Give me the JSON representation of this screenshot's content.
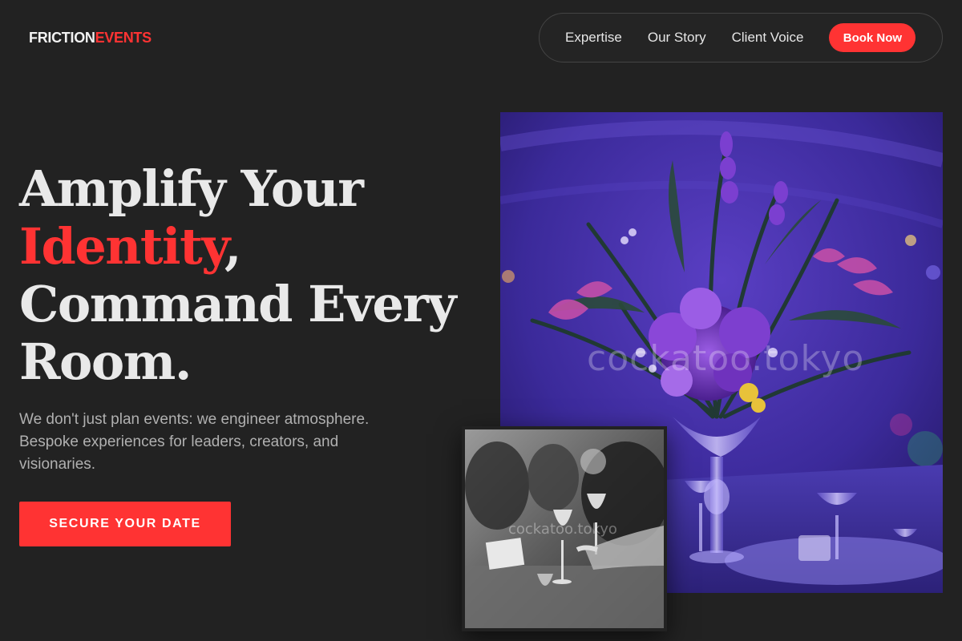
{
  "header": {
    "logo_word1": "FRICTION",
    "logo_word2": "EVENTS",
    "nav": {
      "items": [
        {
          "label": "Expertise"
        },
        {
          "label": "Our Story"
        },
        {
          "label": "Client Voice"
        }
      ],
      "book_label": "Book Now"
    }
  },
  "hero": {
    "headline_line1": "Amplify Your",
    "headline_accent": "Identity",
    "headline_comma": ",",
    "headline_line3": "Command Every",
    "headline_line4": "Room.",
    "subtext": "We don't just plan events: we engineer atmosphere. Bespoke experiences for leaders, creators, and visionaries.",
    "cta_label": "SECURE YOUR DATE"
  },
  "images": {
    "main": {
      "watermark": "cockatoo.tokyo"
    },
    "small": {
      "watermark": "cockatoo.tokyo"
    }
  },
  "colors": {
    "background": "#222222",
    "accent": "#ff3333",
    "text": "#e9e9e9",
    "muted": "#b0b0b0"
  }
}
